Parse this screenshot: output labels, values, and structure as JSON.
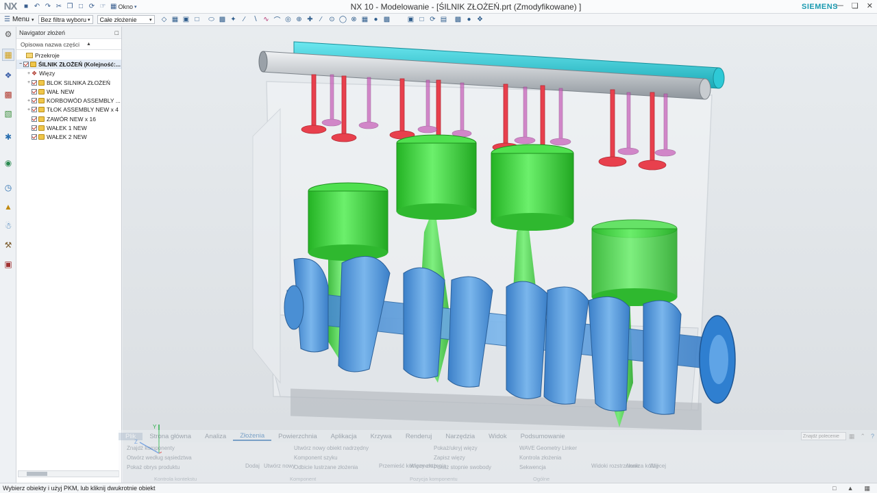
{
  "app": {
    "logo": "NX",
    "title": "NX 10 - Modelowanie - [ŚILNIK ZŁOŻEŃ.prt (Zmodyfikowane) ]",
    "brand": "SIEMENS",
    "window_menu_label": "Okno"
  },
  "toolbar": {
    "menu_label": "Menu",
    "filter_value": "Bez filtra wyboru",
    "scope_value": "Całe złożenie"
  },
  "navigator": {
    "title": "Navigator złożeń",
    "column_header": "Opisowa nazwa części",
    "items": [
      {
        "label": "Przekroje",
        "type": "folder"
      },
      {
        "label": "ŚILNIK ZŁOŻEŃ (Kolejność:...",
        "type": "root"
      },
      {
        "label": "Więzy",
        "type": "constraints"
      },
      {
        "label": "BLOK SILNIKA ZŁOŻEŃ",
        "type": "part"
      },
      {
        "label": "WAŁ NEW",
        "type": "part"
      },
      {
        "label": "KORBOWÓD ASSEMBLY ...",
        "type": "part"
      },
      {
        "label": "TŁOK ASSEMBLY NEW x 4",
        "type": "part"
      },
      {
        "label": "ZAWÓR NEW x 16",
        "type": "part"
      },
      {
        "label": "WAŁEK 1 NEW",
        "type": "part"
      },
      {
        "label": "WAŁEK 2 NEW",
        "type": "part"
      }
    ]
  },
  "ribbon": {
    "tabs": [
      "Plik",
      "Strona główna",
      "Analiza",
      "Złożenia",
      "Powierzchnia",
      "Aplikacja",
      "Krzywa",
      "Renderuj",
      "Narzędzia",
      "Widok",
      "Podsumowanie"
    ],
    "search_placeholder": "Znajdź polecenie",
    "buttons": {
      "find_component": "Znajdź komponenty",
      "open_by_proximity": "Otwórz według sąsiedztwa",
      "show_product_outline": "Pokaż obrys produktu",
      "add": "Dodaj",
      "create_new": "Utwórz nowy",
      "create_new_parent": "Utwórz nowy obiekt nadrzędny",
      "component_array": "Komponent szyku",
      "mirror_assembly": "Odbicie lustrzane złożenia",
      "move_component": "Przemieść komponent",
      "constraints": "Więzy złożenia",
      "show_hide_constraints": "Pokaż/ukryj więzy",
      "remember_constraints": "Zapisz więzy",
      "show_dof": "Pokaż stopnie swobody",
      "wave_linker": "WAVE Geometry Linker",
      "assembly_check": "Kontrola złożenia",
      "sequence": "Sekwencja",
      "exploded_views": "Widoki rozstrzelone",
      "collision": "Analiza kolizji",
      "more": "Więcej"
    },
    "groups": {
      "context_control": "Kontrola kontekstu",
      "component": "Komponent",
      "component_position": "Pozycja komponentu",
      "general": "Ogólne"
    }
  },
  "status": {
    "message": "Wybierz obiekty i użyj PKM, lub kliknij dwukrotnie obiekt"
  },
  "triad": {
    "y_label": "Y",
    "z_label": "Z",
    "x_label": "X"
  },
  "colors": {
    "camshaft_cyan": "#2ec9d6",
    "camshaft_gray": "#c8ccd0",
    "valve_red": "#e8404d",
    "piston_green": "#3bd33b",
    "crank_blue": "#5a9ee0",
    "brand_teal": "#1a9ab0"
  }
}
